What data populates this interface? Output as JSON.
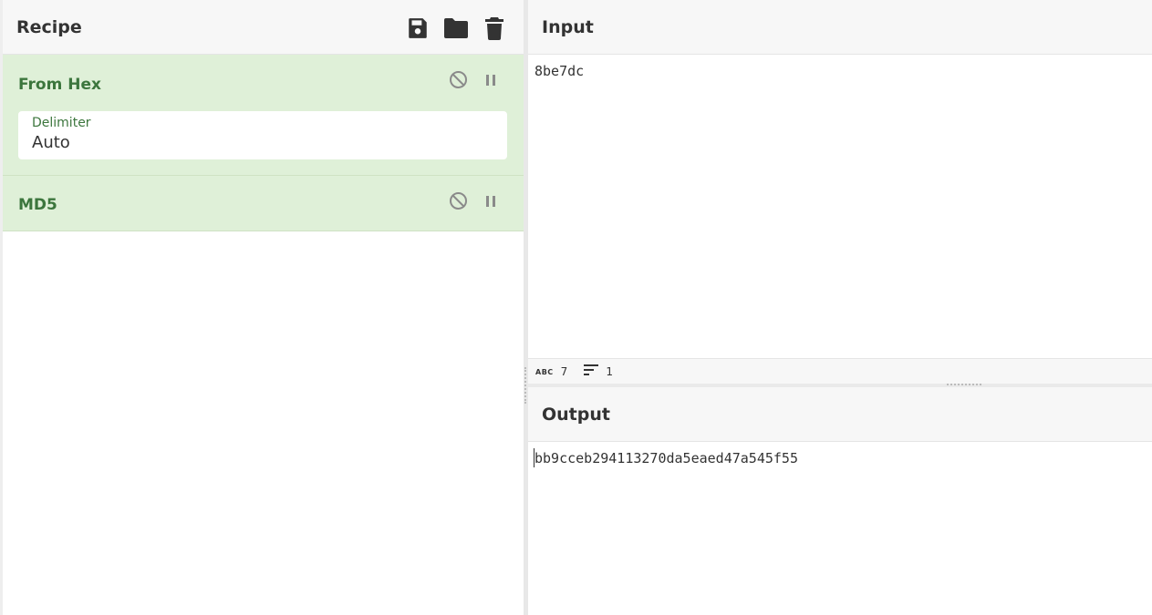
{
  "recipe": {
    "title": "Recipe",
    "icons": [
      "save-icon",
      "folder-icon",
      "trash-icon"
    ]
  },
  "operations": [
    {
      "title": "From Hex",
      "args": [
        {
          "label": "Delimiter",
          "value": "Auto"
        }
      ],
      "controls": [
        "disable-icon",
        "pause-icon"
      ]
    },
    {
      "title": "MD5",
      "controls": [
        "disable-icon",
        "pause-icon"
      ]
    }
  ],
  "input": {
    "title": "Input",
    "value": "8be7dc",
    "stats": {
      "chars": "7",
      "lines": "1",
      "chars_glyph": "ABC"
    }
  },
  "output": {
    "title": "Output",
    "value": "bb9cceb294113270da5eaed47a545f55"
  },
  "colors": {
    "operation_bg": "#dff0d8",
    "operation_text": "#3c763d",
    "header_bg": "#f7f7f7"
  }
}
